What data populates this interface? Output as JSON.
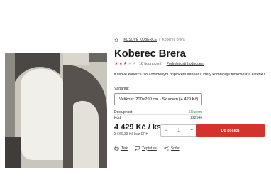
{
  "breadcrumb": {
    "sep1": "/",
    "category": "KUSOVÉ KOBERCE",
    "sep2": "/",
    "current": "Koberec Brera"
  },
  "product": {
    "title": "Koberec Brera",
    "rating_text": "16 hodnocení",
    "rating_detail_link": "Podrobnosti hodnocení",
    "rating_value": 3,
    "rating_max": 5,
    "description": "Kusové koberce jsou oblíbeným doplňkem interiéru, který kombinuje funkčnost a estetiku.",
    "variant_label": "Varianta:",
    "variant_value": "Velikost: 200×290 cm - Skladem  (4 429 Kč)"
  },
  "stock": {
    "availability_label": "Dostupnost",
    "availability_value": "Skladem",
    "code_label": "Kód:",
    "code_value": "222546"
  },
  "pricing": {
    "price": "4 429 Kč / ks",
    "price_without_vat": "3 660,33 Kč bez DPH"
  },
  "cart": {
    "minus": "−",
    "quantity": "1",
    "plus": "+",
    "add_label": "Do košíku"
  },
  "actions": {
    "print": "Tisk",
    "ask": "Zeptat se",
    "share": "Sdílet"
  },
  "colors": {
    "accent": "#d4322c",
    "in_stock": "#2e9a3e",
    "star_full": "#d6322e"
  }
}
